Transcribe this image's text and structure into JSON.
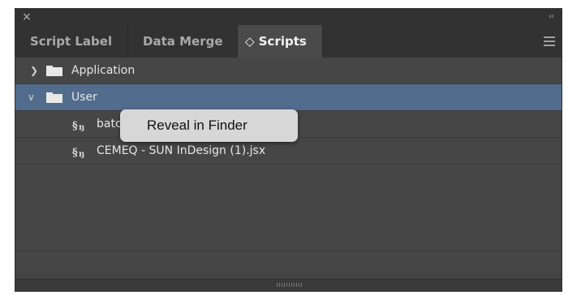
{
  "window": {
    "close_glyph": "×",
    "collapse_glyph": "‹‹"
  },
  "tabs": [
    {
      "label": "Script Label",
      "active": false
    },
    {
      "label": "Data Merge",
      "active": false
    },
    {
      "label": "◇ Scripts",
      "active": true
    }
  ],
  "tree": {
    "rows": [
      {
        "label": "Application",
        "kind": "folder",
        "expanded": false,
        "selected": false
      },
      {
        "label": "User",
        "kind": "folder",
        "expanded": true,
        "selected": true
      },
      {
        "label": "batc",
        "kind": "script",
        "selected": false
      },
      {
        "label": "CEMEQ - SUN InDesign (1).jsx",
        "kind": "script",
        "selected": false
      }
    ]
  },
  "context_menu": {
    "item": "Reveal in Finder"
  },
  "colors": {
    "panel_bg": "#434343",
    "selected_row": "#526c8d",
    "menu_bg": "#d7d7d7"
  }
}
